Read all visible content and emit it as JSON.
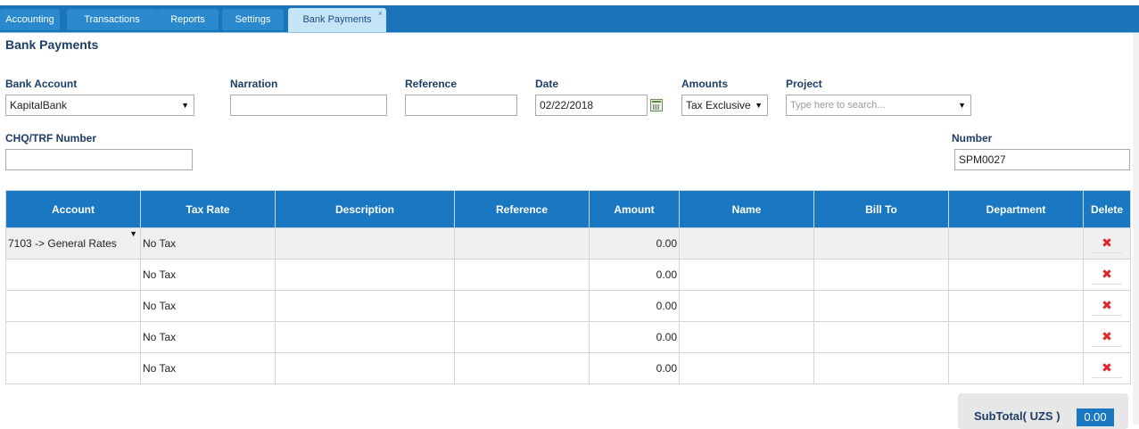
{
  "tabs": [
    {
      "label": "Accounting"
    },
    {
      "label": "Transactions"
    },
    {
      "label": "Reports"
    },
    {
      "label": "Settings"
    },
    {
      "label": "Bank Payments",
      "close": "×"
    }
  ],
  "page": {
    "title": "Bank Payments"
  },
  "form": {
    "bank_account": {
      "label": "Bank Account",
      "value": "KapitalBank"
    },
    "narration": {
      "label": "Narration",
      "value": ""
    },
    "reference": {
      "label": "Reference",
      "value": ""
    },
    "date": {
      "label": "Date",
      "value": "02/22/2018"
    },
    "amounts": {
      "label": "Amounts",
      "value": "Tax Exclusive"
    },
    "project": {
      "label": "Project",
      "placeholder": "Type here to search..."
    },
    "chq": {
      "label": "CHQ/TRF Number",
      "value": ""
    },
    "number": {
      "label": "Number",
      "value": "SPM0027"
    }
  },
  "grid": {
    "headers": [
      "Account",
      "Tax Rate",
      "Description",
      "Reference",
      "Amount",
      "Name",
      "Bill To",
      "Department",
      "Delete"
    ],
    "rows": [
      {
        "account": "7103 -> General Rates",
        "tax_rate": "No Tax",
        "amount": "0.00"
      },
      {
        "account": "",
        "tax_rate": "No Tax",
        "amount": "0.00"
      },
      {
        "account": "",
        "tax_rate": "No Tax",
        "amount": "0.00"
      },
      {
        "account": "",
        "tax_rate": "No Tax",
        "amount": "0.00"
      },
      {
        "account": "",
        "tax_rate": "No Tax",
        "amount": "0.00"
      }
    ],
    "delete_icon": "✖"
  },
  "footer": {
    "subtotal_label": "SubTotal( UZS )",
    "subtotal_value": "0.00"
  },
  "colors": {
    "header_blue": "#1a78c2",
    "tab_band": "#1b73b8",
    "delete_red": "#e0282c"
  }
}
